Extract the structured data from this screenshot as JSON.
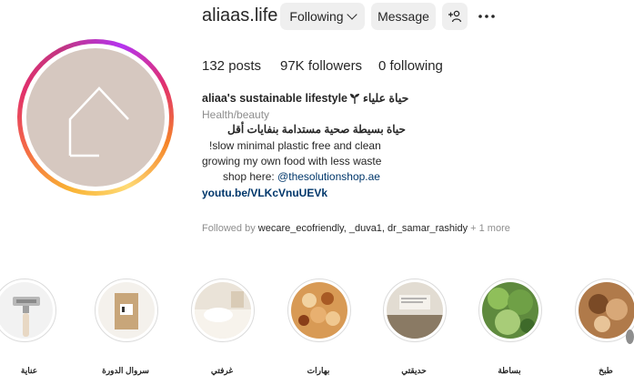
{
  "profile": {
    "username": "aliaas.life",
    "following_button": "Following",
    "message_button": "Message",
    "add_user_glyph": "+ዳ"
  },
  "stats": {
    "posts": "132",
    "posts_label": "posts",
    "followers": "97K",
    "followers_label": "followers",
    "following": "0",
    "following_label": "following"
  },
  "bio": {
    "name": "aliaa's sustainable lifestyle",
    "name_arabic": "حياة علياء",
    "category": "Health/beauty",
    "line1": "حياة بسيطة صحية مستدامة بنفايات أقل",
    "line2": "!slow minimal plastic free and clean",
    "line3": "growing my own food with less waste",
    "line4_prefix": "shop here: ",
    "line4_link": "@thesolutionshop.ae",
    "website": "youtu.be/VLKcVnuUEVk",
    "followed_by_prefix": "Followed by ",
    "followed_by_names": "wecare_ecofriendly, _duva1, dr_samar_rashidy",
    "followed_by_more": " + 1 more"
  },
  "highlights": [
    {
      "label": "عناية",
      "icon": "razor"
    },
    {
      "label": "سروال الدورة",
      "icon": "product-box"
    },
    {
      "label": "غرفتي",
      "icon": "bedroom"
    },
    {
      "label": "بهارات",
      "icon": "spices"
    },
    {
      "label": "حديقتي",
      "icon": "garden"
    },
    {
      "label": "بساطة",
      "icon": "plant"
    },
    {
      "label": "طبخ",
      "icon": "food"
    }
  ],
  "colors": {
    "button_bg": "#efefef",
    "link": "#00376b",
    "muted": "#8e8e8e",
    "avatar_bg": "#d6c8c0"
  }
}
